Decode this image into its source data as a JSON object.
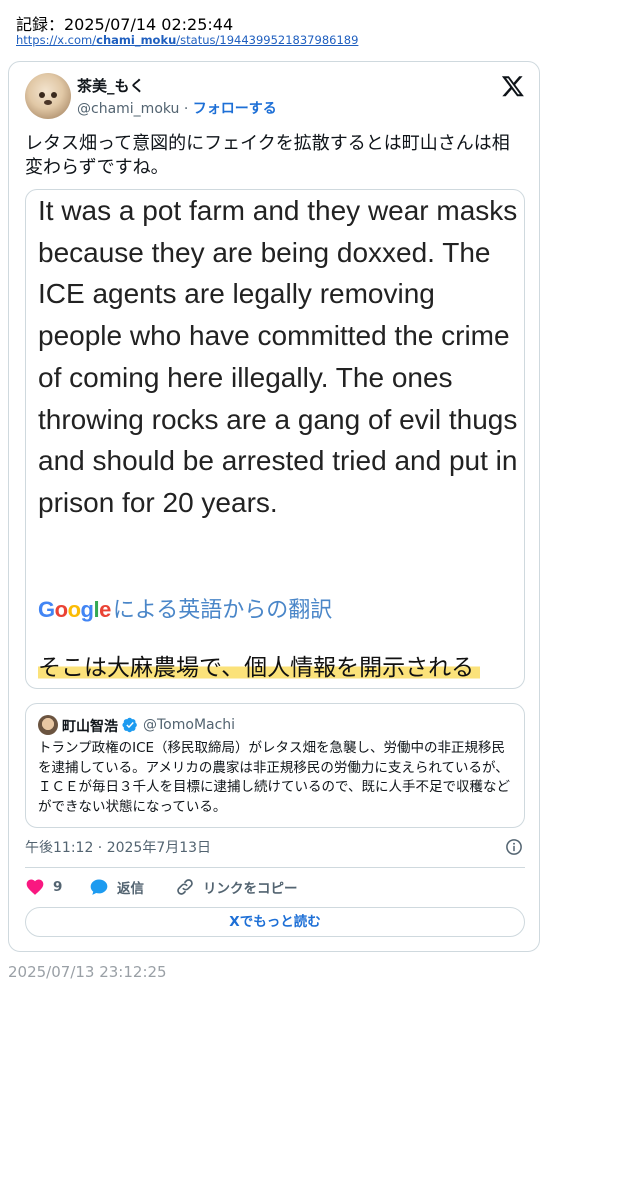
{
  "record": {
    "line": "記録：2025/07/14 02:25:44",
    "url_prefix": "https://x.com/",
    "url_user": "chami_moku",
    "url_suffix": "/status/1944399521837986189"
  },
  "tweet": {
    "author_name": "茶美_もく",
    "author_handle": "@chami_moku",
    "separator": "·",
    "follow_label": "フォローする",
    "text": "レタス畑って意図的にフェイクを拡散するとは町山さんは相変わらずですね。",
    "media": {
      "english_text": "It was a pot farm and they wear masks because they are being doxxed. The ICE agents are legally removing people who have committed the crime of coming here illegally. The ones throwing rocks are a gang of evil thugs and should be arrested tried and put in prison for 20 years.",
      "google_label": "Google",
      "translation_via": "による英語からの翻訳",
      "japanese_text": "そこは大麻農場で、個人情報を開示される"
    },
    "quote": {
      "name": "町山智浩",
      "handle": "@TomoMachi",
      "text": "トランプ政権のICE（移民取締局）がレタス畑を急襲し、労働中の非正規移民を逮捕している。アメリカの農家は非正規移民の労働力に支えられているが、ＩＣＥが毎日３千人を目標に逮捕し続けているので、既に人手不足で収穫などができない状態になっている。"
    },
    "datetime": "午後11:12 · 2025年7月13日",
    "likes": "9",
    "reply_label": "返信",
    "copy_link_label": "リンクをコピー",
    "read_more_label": "Xでもっと読む"
  },
  "footer_timestamp": "2025/07/13 23:12:25",
  "colors": {
    "accent": "#1d6fd6",
    "like": "#f91880",
    "reply": "#1d9bf0",
    "border": "#cfd9de",
    "muted": "#536471",
    "highlight": "#fbe27a"
  }
}
